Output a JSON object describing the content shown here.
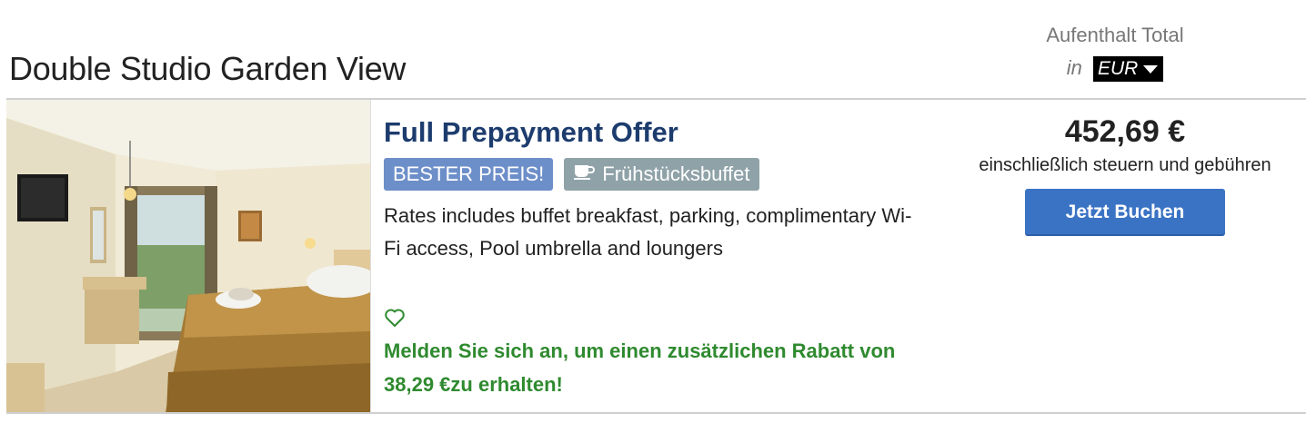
{
  "room": {
    "title": "Double Studio Garden View"
  },
  "total": {
    "label": "Aufenthalt Total",
    "in_word": "in",
    "currency": "EUR"
  },
  "offer": {
    "title": "Full Prepayment Offer",
    "badges": {
      "best_price": "BESTER PREIS!",
      "breakfast": "Frühstücksbuffet"
    },
    "description": "Rates includes buffet breakfast, parking, complimentary Wi-Fi access, Pool umbrella and loungers",
    "login_promo": {
      "before": "Melden Sie sich an, um einen zusätzlichen Rabatt von ",
      "amount": "38,29 €",
      "after": "zu erhalten!"
    }
  },
  "price": {
    "amount": "452,69 €",
    "tax_note": "einschließlich steuern und gebühren",
    "book_label": "Jetzt Buchen"
  },
  "colors": {
    "offer_title": "#1d3c6e",
    "best_price_badge": "#6d8fc9",
    "breakfast_badge": "#8fa2a8",
    "promo_green": "#2f8a2f",
    "book_button": "#3b73c4"
  }
}
